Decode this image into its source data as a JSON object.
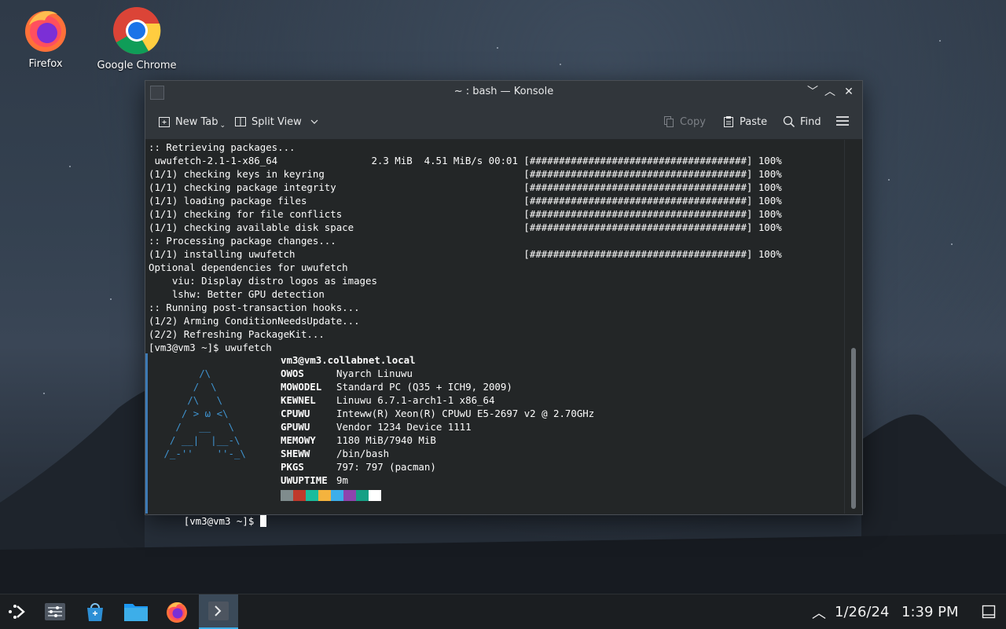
{
  "desktop": {
    "icons": [
      {
        "label": "Firefox",
        "icon": "firefox-icon"
      },
      {
        "label": "Google Chrome",
        "icon": "chrome-icon"
      }
    ]
  },
  "window": {
    "title": "~ : bash — Konsole",
    "controls": {
      "minimize": "﹀",
      "maximize": "︿",
      "close": "✕"
    }
  },
  "toolbar": {
    "new_tab": "New Tab",
    "split_view": "Split View",
    "copy": "Copy",
    "paste": "Paste",
    "find": "Find"
  },
  "terminal": {
    "lines": [
      ":: Retrieving packages...",
      " uwufetch-2.1-1-x86_64                2.3 MiB  4.51 MiB/s 00:01 [#####################################] 100%",
      "(1/1) checking keys in keyring                                  [#####################################] 100%",
      "(1/1) checking package integrity                                [#####################################] 100%",
      "(1/1) loading package files                                     [#####################################] 100%",
      "(1/1) checking for file conflicts                               [#####################################] 100%",
      "(1/1) checking available disk space                             [#####################################] 100%",
      ":: Processing package changes...",
      "(1/1) installing uwufetch                                       [#####################################] 100%",
      "Optional dependencies for uwufetch",
      "    viu: Display distro logos as images",
      "    lshw: Better GPU detection",
      ":: Running post-transaction hooks...",
      "(1/2) Arming ConditionNeedsUpdate...",
      "(2/2) Refreshing PackageKit...",
      "[vm3@vm3 ~]$ uwufetch"
    ],
    "ascii_art": [
      "",
      "       /\\",
      "      /  \\",
      "     /\\   \\",
      "    / > ω <\\",
      "   /   __   \\",
      "  / __|  |__-\\",
      " /_-''    ''-_\\"
    ],
    "fetch_host": "vm3@vm3.collabnet.local",
    "fetch_info": [
      {
        "key": "OWOS",
        "value": "Nyarch Linuwu"
      },
      {
        "key": "MOWODEL",
        "value": "Standard PC (Q35 + ICH9, 2009)"
      },
      {
        "key": "KEWNEL",
        "value": "Linuwu 6.7.1-arch1-1 x86_64"
      },
      {
        "key": "CPUWU",
        "value": "Inteww(R) Xeon(R) CPUwU E5-2697 v2 @ 2.70GHz"
      },
      {
        "key": "GPUWU",
        "value": "Vendor 1234 Device 1111"
      },
      {
        "key": "MEMOWY",
        "value": "1180 MiB/7940 MiB"
      },
      {
        "key": "SHEWW",
        "value": "/bin/bash"
      },
      {
        "key": "PKGS",
        "value": "797: 797 (pacman)"
      },
      {
        "key": "UWUPTIME",
        "value": "9m"
      }
    ],
    "palette": [
      "#7f8c8d",
      "#c0392b",
      "#1abc9c",
      "#f4b33e",
      "#3daee9",
      "#8e44ad",
      "#16a085",
      "#ffffff"
    ],
    "prompt": "[vm3@vm3 ~]$ "
  },
  "taskbar": {
    "items": [
      "launcher-icon",
      "system-settings-icon",
      "discover-store-icon",
      "file-manager-icon",
      "firefox-icon",
      "konsole-icon"
    ],
    "tray_arrow": "︿",
    "date": "1/26/24",
    "time": "1:39 PM",
    "show_desktop": "show-desktop-icon"
  }
}
